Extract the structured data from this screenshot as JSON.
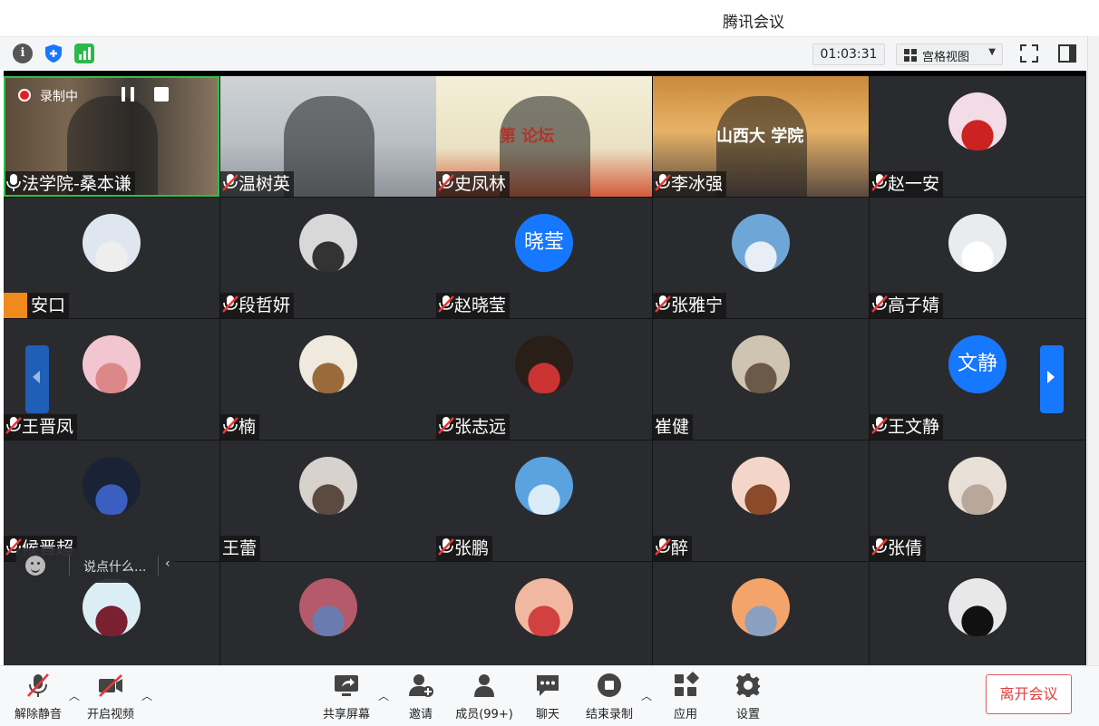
{
  "window": {
    "title": "腾讯会议"
  },
  "toolbar": {
    "timer": "01:03:31",
    "view_label": "宫格视图"
  },
  "recording": {
    "label": "录制中"
  },
  "participants": [
    {
      "name": "法学院-桑本谦",
      "mic": "on",
      "avatar": "video-bookshelf",
      "active": true
    },
    {
      "name": "温树英",
      "mic": "muted",
      "avatar": "video-woman-glasses"
    },
    {
      "name": "史凤林",
      "mic": "muted",
      "avatar": "video-forum-banner",
      "banner_text": "第 论坛"
    },
    {
      "name": "李冰强",
      "mic": "muted",
      "avatar": "video-law-school",
      "banner_text": "山西大 学院"
    },
    {
      "name": "赵一安",
      "mic": "muted",
      "avatar": "photo-man-red"
    },
    {
      "name": "安口",
      "mic": "none",
      "avatar": "photo-anime-girl"
    },
    {
      "name": "段哲妍",
      "mic": "muted",
      "avatar": "photo-bw-woman"
    },
    {
      "name": "赵晓莹",
      "mic": "muted",
      "avatar_text": "晓莹"
    },
    {
      "name": "张雅宁",
      "mic": "muted",
      "avatar": "photo-snow-trees"
    },
    {
      "name": "高子婧",
      "mic": "muted",
      "avatar": "photo-white-rabbit"
    },
    {
      "name": "王晋凤",
      "mic": "muted",
      "avatar": "photo-woman-pink"
    },
    {
      "name": "楠",
      "mic": "muted",
      "avatar": "photo-cats"
    },
    {
      "name": "张志远",
      "mic": "muted",
      "avatar": "photo-man-flag"
    },
    {
      "name": "崔健",
      "mic": "none",
      "avatar": "photo-silhouette"
    },
    {
      "name": "王文静",
      "mic": "muted",
      "avatar_text": "文静"
    },
    {
      "name": "候晋超",
      "mic": "muted",
      "avatar": "photo-blue-cartoon"
    },
    {
      "name": "王蕾",
      "mic": "none",
      "avatar": "photo-cat-dark"
    },
    {
      "name": "张鹏",
      "mic": "muted",
      "avatar": "photo-sky-lake"
    },
    {
      "name": "醉",
      "mic": "muted",
      "avatar": "photo-cartoon-girl"
    },
    {
      "name": "张倩",
      "mic": "muted",
      "avatar": "photo-girl-soft"
    },
    {
      "name": "",
      "mic": "muted",
      "avatar": "photo-cartoon-boy"
    },
    {
      "name": "",
      "mic": "none",
      "avatar": "photo-shark"
    },
    {
      "name": "",
      "mic": "none",
      "avatar": "photo-dancer"
    },
    {
      "name": "",
      "mic": "muted",
      "avatar": "photo-sunset-girl"
    },
    {
      "name": "",
      "mic": "muted",
      "avatar": "photo-black-cat"
    }
  ],
  "chat": {
    "placeholder": "说点什么..."
  },
  "bottombar": {
    "unmute": "解除静音",
    "start_video": "开启视频",
    "share": "共享屏幕",
    "invite": "邀请",
    "members": "成员(99+)",
    "chat": "聊天",
    "stop_record": "结束录制",
    "apps": "应用",
    "settings": "设置",
    "leave": "离开会议"
  },
  "colors": {
    "accent": "#1677ff",
    "recording": "#e02020",
    "leave": "#e03c3c",
    "active_speaker": "#2fbf4a"
  }
}
